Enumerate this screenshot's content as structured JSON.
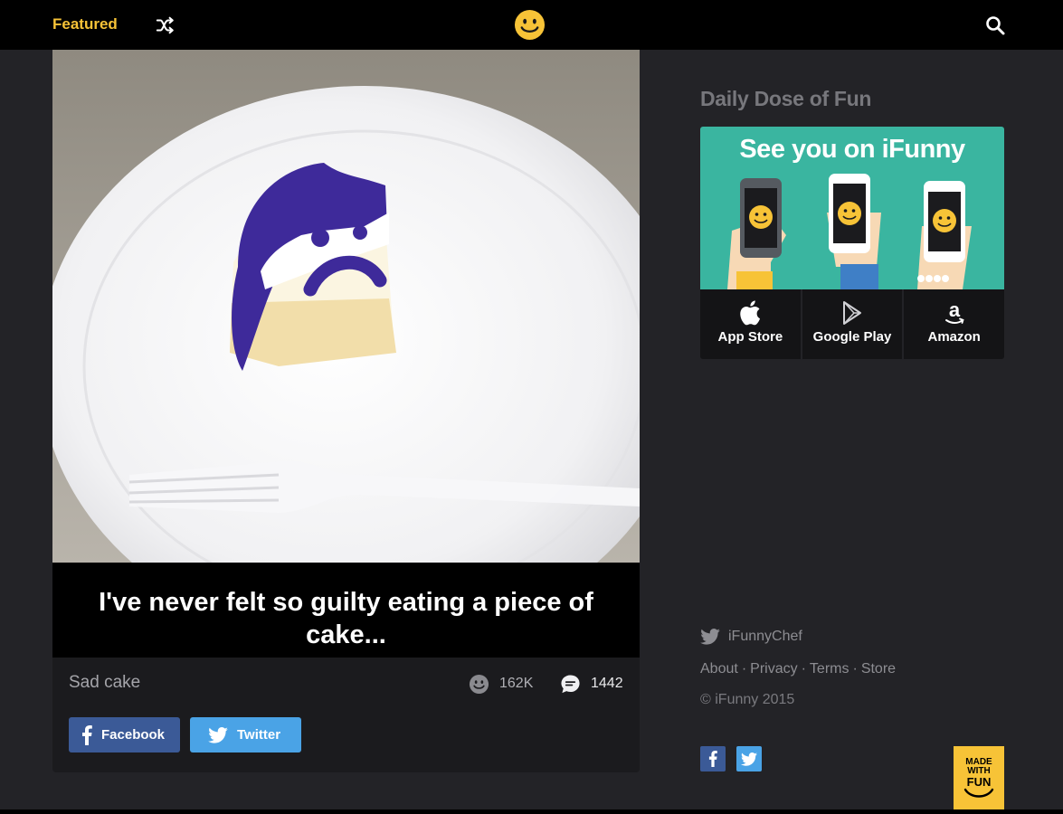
{
  "nav": {
    "featured_label": "Featured"
  },
  "post": {
    "caption": "I've never felt so guilty eating a piece of cake...",
    "title": "Sad cake",
    "smiles": "162K",
    "comments": "1442",
    "share_facebook": "Facebook",
    "share_twitter": "Twitter"
  },
  "sidebar": {
    "heading": "Daily Dose of Fun",
    "promo_title": "See you on iFunny",
    "stores": [
      {
        "label": "App Store",
        "icon": "apple-icon"
      },
      {
        "label": "Google Play",
        "icon": "google-play-icon"
      },
      {
        "label": "Amazon",
        "icon": "amazon-icon"
      }
    ]
  },
  "footer": {
    "twitter_handle": "iFunnyChef",
    "links": [
      "About",
      "Privacy",
      "Terms",
      "Store"
    ],
    "copyright": "© iFunny 2015",
    "badge": [
      "MADE",
      "WITH",
      "FUN"
    ]
  },
  "colors": {
    "accent": "#f7c337",
    "background": "#232327",
    "facebook": "#3b5a97",
    "twitter": "#4aa3e6",
    "promo": "#3ab5a0"
  }
}
